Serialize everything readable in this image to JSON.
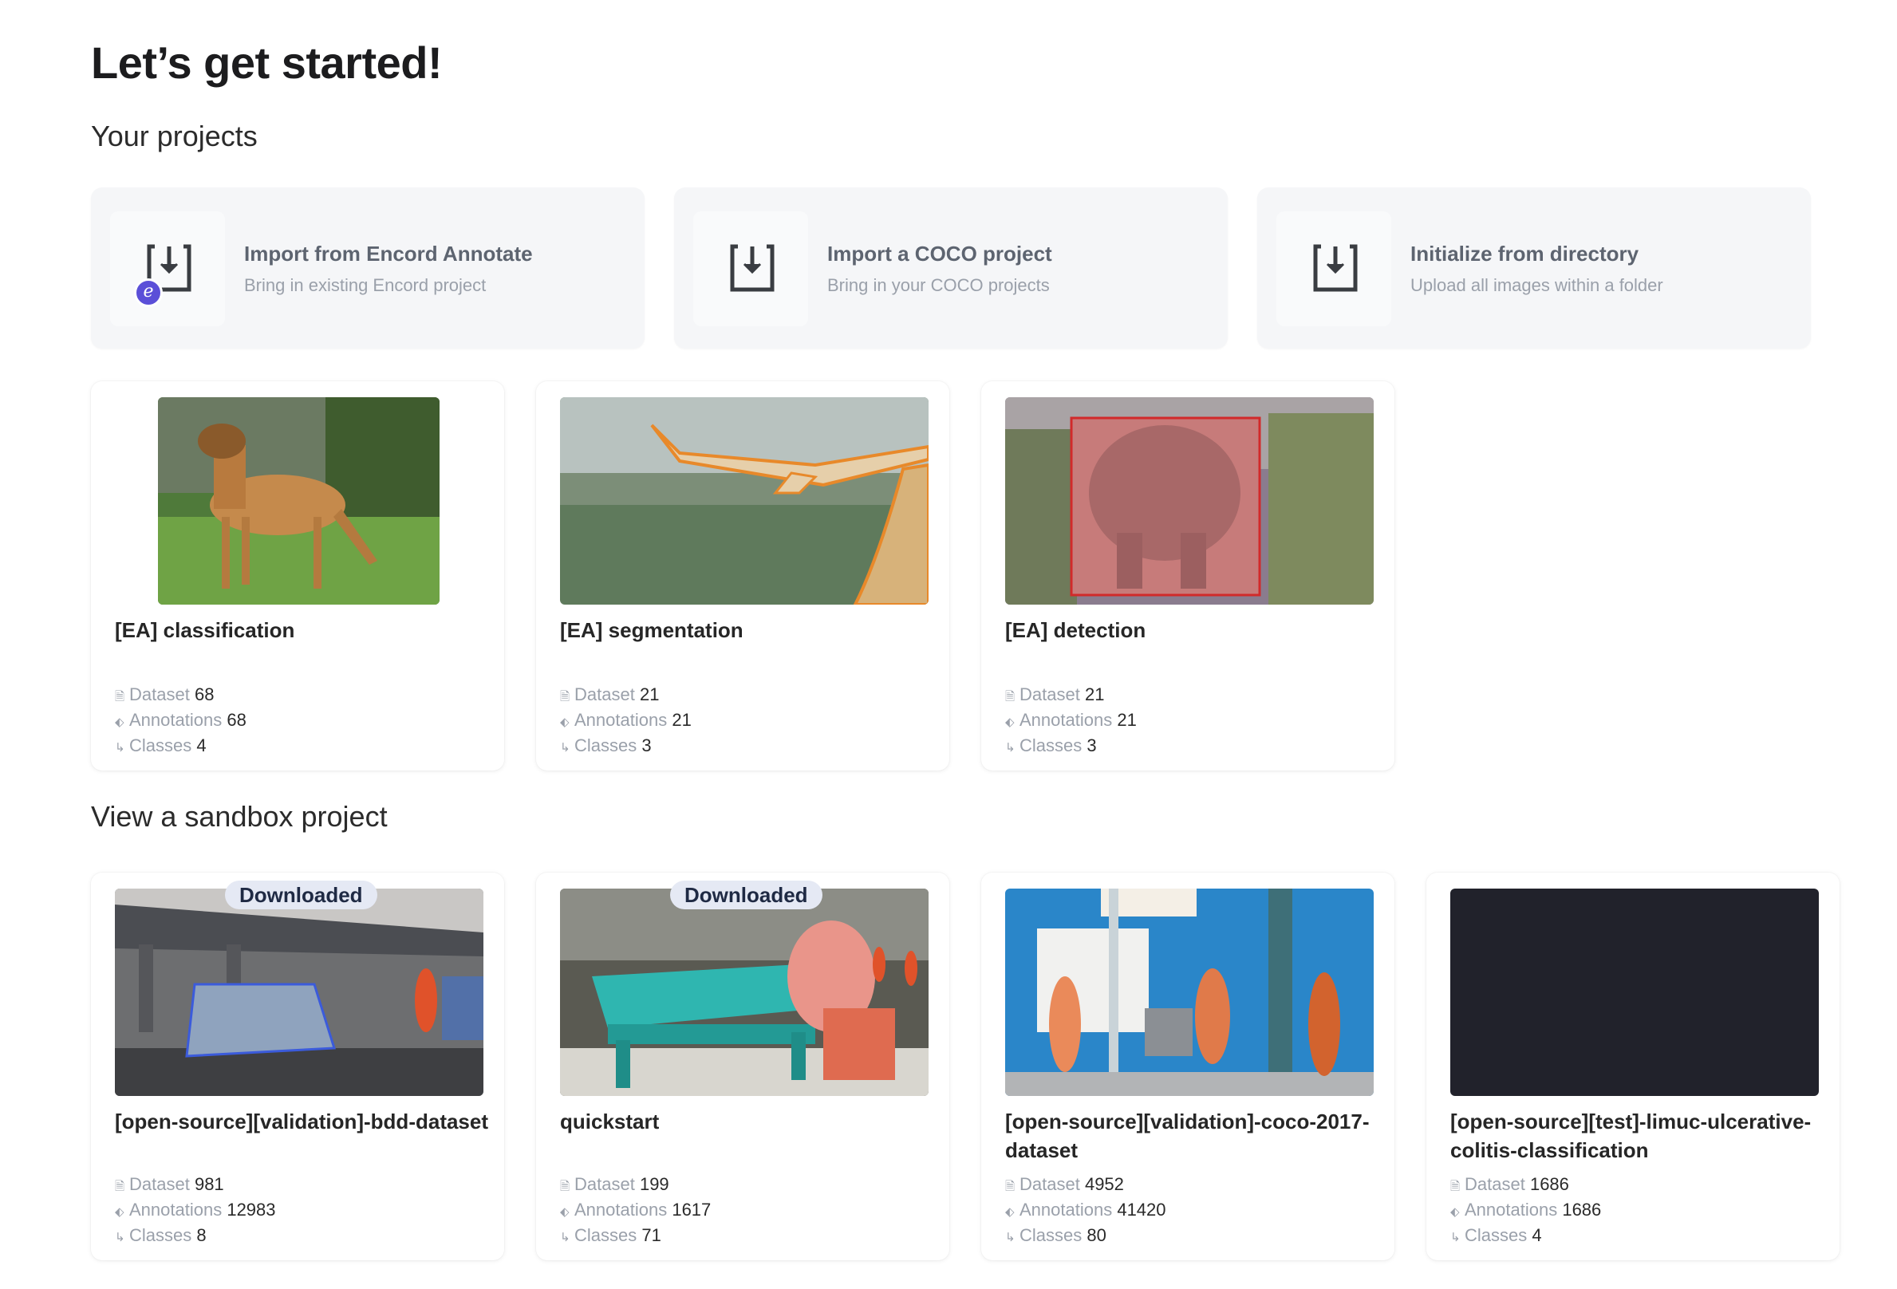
{
  "page": {
    "title": "Let’s get started!"
  },
  "sections": {
    "your_projects": "Your projects",
    "sandbox": "View a sandbox project"
  },
  "imports": [
    {
      "title": "Import from Encord Annotate",
      "subtitle": "Bring in existing Encord project",
      "icon": "download-tray-icon",
      "badge_icon": "encord-logo-icon"
    },
    {
      "title": "Import a COCO project",
      "subtitle": "Bring in your COCO projects",
      "icon": "download-tray-icon"
    },
    {
      "title": "Initialize from directory",
      "subtitle": "Upload all images within a folder",
      "icon": "download-tray-icon"
    }
  ],
  "labels": {
    "dataset": "Dataset",
    "annotations": "Annotations",
    "classes": "Classes",
    "downloaded": "Downloaded"
  },
  "projects": [
    {
      "name": "[EA] classification",
      "dataset": "68",
      "annotations": "68",
      "classes": "4"
    },
    {
      "name": "[EA] segmentation",
      "dataset": "21",
      "annotations": "21",
      "classes": "3"
    },
    {
      "name": "[EA] detection",
      "dataset": "21",
      "annotations": "21",
      "classes": "3"
    }
  ],
  "sandbox": [
    {
      "name": "[open-source][validation]-bdd-dataset",
      "dataset": "981",
      "annotations": "12983",
      "classes": "8"
    },
    {
      "name": "quickstart",
      "dataset": "199",
      "annotations": "1617",
      "classes": "71"
    },
    {
      "name": "[open-source][validation]-coco-2017-dataset",
      "dataset": "4952",
      "annotations": "41420",
      "classes": "80"
    },
    {
      "name": "[open-source][test]-limuc-ulcerative-colitis-classification",
      "dataset": "1686",
      "annotations": "1686",
      "classes": "4"
    }
  ],
  "colors": {
    "encord_purple": "#5b4fd8",
    "card_bg": "#f5f6f8",
    "badge_bg": "#e5e9f4",
    "dark_thumb": "#21222b"
  }
}
